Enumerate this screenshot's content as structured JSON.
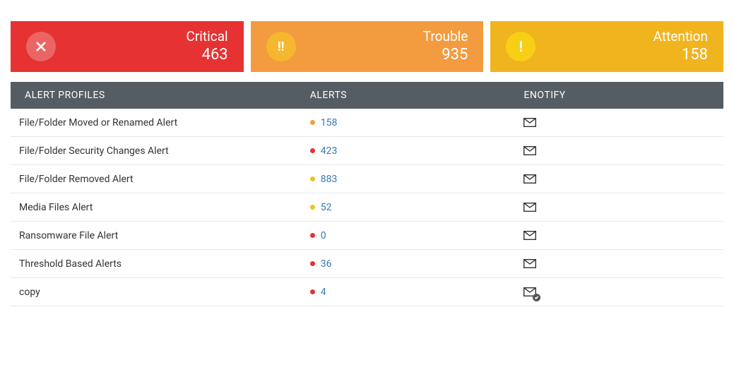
{
  "cards": {
    "critical": {
      "label": "Critical",
      "count": "463",
      "icon": "close-icon",
      "bg": "#e63232"
    },
    "trouble": {
      "label": "Trouble",
      "count": "935",
      "icon": "double-bang-icon",
      "bg": "#f39c3f"
    },
    "attention": {
      "label": "Attention",
      "count": "158",
      "icon": "bang-icon",
      "bg": "#f0b41e"
    }
  },
  "headers": {
    "profiles": "ALERT PROFILES",
    "alerts": "ALERTS",
    "enotify": "ENOTIFY"
  },
  "rows": [
    {
      "name": "File/Folder Moved or Renamed Alert",
      "count": "158",
      "severity": "orange",
      "enotify": "mail"
    },
    {
      "name": "File/Folder Security Changes Alert",
      "count": "423",
      "severity": "red",
      "enotify": "mail"
    },
    {
      "name": "File/Folder Removed Alert",
      "count": "883",
      "severity": "yellow",
      "enotify": "mail"
    },
    {
      "name": "Media Files Alert",
      "count": "52",
      "severity": "yellow",
      "enotify": "mail"
    },
    {
      "name": "Ransomware File Alert",
      "count": "0",
      "severity": "red",
      "enotify": "mail"
    },
    {
      "name": "Threshold Based Alerts",
      "count": "36",
      "severity": "red",
      "enotify": "mail"
    },
    {
      "name": "copy",
      "count": "4",
      "severity": "red",
      "enotify": "mail-check"
    }
  ],
  "glyphs": {
    "double_bang": "!!",
    "bang": "!"
  }
}
